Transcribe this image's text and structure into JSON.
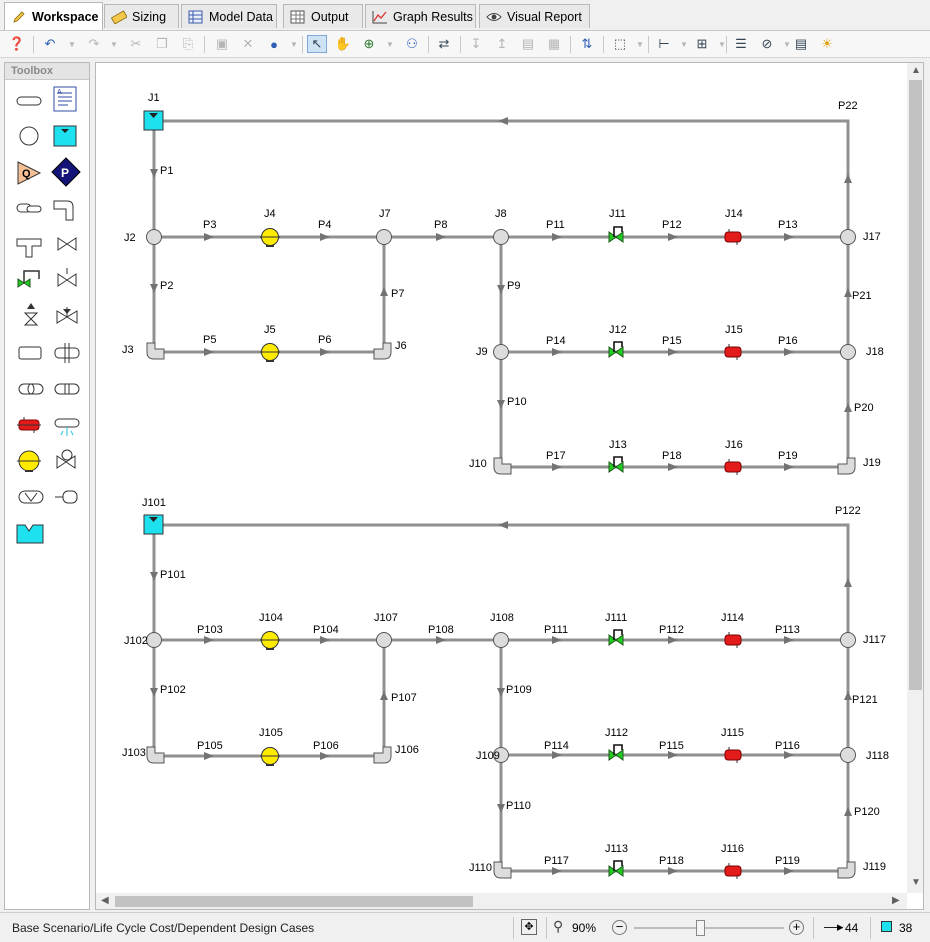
{
  "tabs": [
    {
      "label": "Workspace",
      "icon": "pencil-icon"
    },
    {
      "label": "Sizing",
      "icon": "ruler-icon"
    },
    {
      "label": "Model Data",
      "icon": "grid-icon"
    },
    {
      "label": "Output",
      "icon": "table-icon"
    },
    {
      "label": "Graph Results",
      "icon": "graph-icon"
    },
    {
      "label": "Visual Report",
      "icon": "eye-icon"
    }
  ],
  "toolbox": {
    "title": "Toolbox"
  },
  "statusbar": {
    "scenario": "Base Scenario/Life Cycle Cost/Dependent Design Cases",
    "zoom": "90%",
    "pipe_count": "44",
    "junction_count": "38"
  },
  "colors": {
    "pipe": "#909090",
    "arrow": "#737373",
    "junction": "#dcdcdc",
    "reservoir": "#1ee1f0",
    "pump": "#ffeb00",
    "valve": "#22cc22",
    "heat_exchanger": "#e41b1b"
  },
  "model": {
    "junctions": [
      {
        "id": "J1",
        "type": "reservoir"
      },
      {
        "id": "J2",
        "type": "branch"
      },
      {
        "id": "J3",
        "type": "bend"
      },
      {
        "id": "J4",
        "type": "pump"
      },
      {
        "id": "J5",
        "type": "pump"
      },
      {
        "id": "J6",
        "type": "bend"
      },
      {
        "id": "J7",
        "type": "branch"
      },
      {
        "id": "J8",
        "type": "branch"
      },
      {
        "id": "J9",
        "type": "branch"
      },
      {
        "id": "J10",
        "type": "bend"
      },
      {
        "id": "J11",
        "type": "valve"
      },
      {
        "id": "J12",
        "type": "valve"
      },
      {
        "id": "J13",
        "type": "valve"
      },
      {
        "id": "J14",
        "type": "heat-exchanger"
      },
      {
        "id": "J15",
        "type": "heat-exchanger"
      },
      {
        "id": "J16",
        "type": "heat-exchanger"
      },
      {
        "id": "J17",
        "type": "branch"
      },
      {
        "id": "J18",
        "type": "branch"
      },
      {
        "id": "J19",
        "type": "bend"
      },
      {
        "id": "J101",
        "type": "reservoir"
      },
      {
        "id": "J102",
        "type": "branch"
      },
      {
        "id": "J103",
        "type": "bend"
      },
      {
        "id": "J104",
        "type": "pump"
      },
      {
        "id": "J105",
        "type": "pump"
      },
      {
        "id": "J106",
        "type": "bend"
      },
      {
        "id": "J107",
        "type": "branch"
      },
      {
        "id": "J108",
        "type": "branch"
      },
      {
        "id": "J109",
        "type": "branch"
      },
      {
        "id": "J110",
        "type": "bend"
      },
      {
        "id": "J111",
        "type": "valve"
      },
      {
        "id": "J112",
        "type": "valve"
      },
      {
        "id": "J113",
        "type": "valve"
      },
      {
        "id": "J114",
        "type": "heat-exchanger"
      },
      {
        "id": "J115",
        "type": "heat-exchanger"
      },
      {
        "id": "J116",
        "type": "heat-exchanger"
      },
      {
        "id": "J117",
        "type": "branch"
      },
      {
        "id": "J118",
        "type": "branch"
      },
      {
        "id": "J119",
        "type": "bend"
      }
    ],
    "pipes": [
      "P1",
      "P2",
      "P3",
      "P4",
      "P5",
      "P6",
      "P7",
      "P8",
      "P9",
      "P10",
      "P11",
      "P12",
      "P13",
      "P14",
      "P15",
      "P16",
      "P17",
      "P18",
      "P19",
      "P20",
      "P21",
      "P22",
      "P101",
      "P102",
      "P103",
      "P104",
      "P105",
      "P106",
      "P107",
      "P108",
      "P109",
      "P110",
      "P111",
      "P112",
      "P113",
      "P114",
      "P115",
      "P116",
      "P117",
      "P118",
      "P119",
      "P120",
      "P121",
      "P122"
    ]
  }
}
